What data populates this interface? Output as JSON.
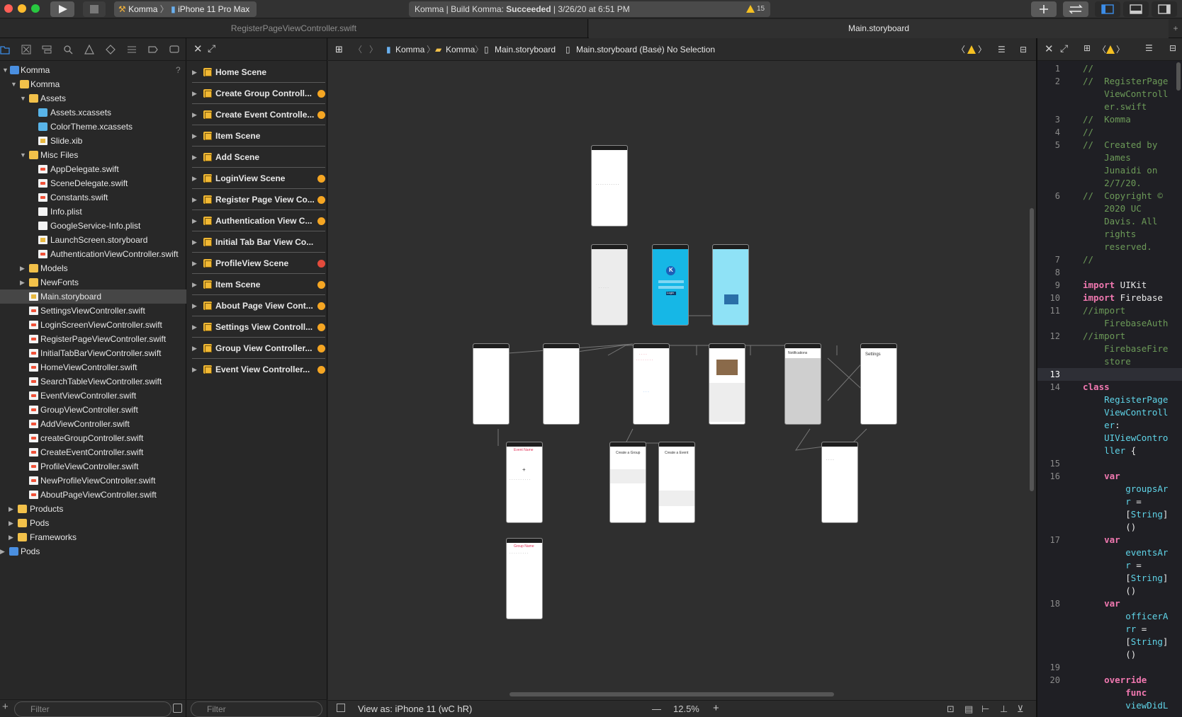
{
  "toolbar": {
    "scheme_project": "Komma",
    "scheme_device": "iPhone 11 Pro Max",
    "status_prefix": "Komma | Build Komma: ",
    "status_result": "Succeeded",
    "status_time": "| 3/26/20 at 6:51 PM",
    "warning_count": "15"
  },
  "tabs": [
    {
      "label": "RegisterPageViewController.swift"
    },
    {
      "label": "Main.storyboard"
    }
  ],
  "navigator": {
    "items": [
      {
        "label": "Komma",
        "help": "?"
      },
      {
        "label": "Komma"
      },
      {
        "label": "Assets"
      },
      {
        "label": "Assets.xcassets"
      },
      {
        "label": "ColorTheme.xcassets"
      },
      {
        "label": "Slide.xib"
      },
      {
        "label": "Misc Files"
      },
      {
        "label": "AppDelegate.swift"
      },
      {
        "label": "SceneDelegate.swift"
      },
      {
        "label": "Constants.swift"
      },
      {
        "label": "Info.plist"
      },
      {
        "label": "GoogleService-Info.plist"
      },
      {
        "label": "LaunchScreen.storyboard"
      },
      {
        "label": "AuthenticationViewController.swift"
      },
      {
        "label": "Models"
      },
      {
        "label": "NewFonts"
      },
      {
        "label": "Main.storyboard"
      },
      {
        "label": "SettingsViewController.swift"
      },
      {
        "label": "LoginScreenViewController.swift"
      },
      {
        "label": "RegisterPageViewController.swift"
      },
      {
        "label": "InitialTabBarViewController.swift"
      },
      {
        "label": "HomeViewController.swift"
      },
      {
        "label": "SearchTableViewController.swift"
      },
      {
        "label": "EventViewController.swift"
      },
      {
        "label": "GroupViewController.swift"
      },
      {
        "label": "AddViewController.swift"
      },
      {
        "label": "createGroupController.swift"
      },
      {
        "label": "CreateEventController.swift"
      },
      {
        "label": "ProfileViewController.swift"
      },
      {
        "label": "NewProfileViewController.swift"
      },
      {
        "label": "AboutPageViewController.swift"
      },
      {
        "label": "Products"
      },
      {
        "label": "Pods"
      },
      {
        "label": "Frameworks"
      },
      {
        "label": "Pods"
      }
    ],
    "filter_placeholder": "Filter"
  },
  "outline": {
    "scenes": [
      {
        "label": "Home Scene",
        "badge": "none"
      },
      {
        "label": "Create Group Controll...",
        "badge": "warning"
      },
      {
        "label": "Create Event Controlle...",
        "badge": "warning"
      },
      {
        "label": "Item Scene",
        "badge": "none"
      },
      {
        "label": "Add Scene",
        "badge": "none"
      },
      {
        "label": "LoginView Scene",
        "badge": "warning"
      },
      {
        "label": "Register Page View Co...",
        "badge": "warning"
      },
      {
        "label": "Authentication View C...",
        "badge": "warning"
      },
      {
        "label": "Initial Tab Bar View Co...",
        "badge": "none"
      },
      {
        "label": "ProfileView Scene",
        "badge": "error"
      },
      {
        "label": "Item Scene",
        "badge": "warning"
      },
      {
        "label": "About Page View Cont...",
        "badge": "warning"
      },
      {
        "label": "Settings View Controll...",
        "badge": "warning"
      },
      {
        "label": "Group View Controller...",
        "badge": "warning"
      },
      {
        "label": "Event View Controller...",
        "badge": "warning"
      }
    ],
    "filter_placeholder": "Filter"
  },
  "jumpbar": {
    "crumbs": [
      "Komma",
      "Komma",
      "Main.storyboard",
      "Main.storyboard (Base)",
      "No Selection"
    ]
  },
  "canvas": {
    "view_as": "View as: iPhone 11 (wC hR)",
    "zoom": "12.5%",
    "minus": "—",
    "plus": "+"
  },
  "editor": {
    "lines": [
      {
        "n": "1",
        "segs": [
          {
            "t": "//",
            "c": "cmt"
          }
        ]
      },
      {
        "n": "2",
        "segs": [
          {
            "t": "//  RegisterPage\n    ViewControll\n    er.swift",
            "c": "cmt"
          }
        ]
      },
      {
        "n": "3",
        "segs": [
          {
            "t": "//  Komma",
            "c": "cmt"
          }
        ]
      },
      {
        "n": "4",
        "segs": [
          {
            "t": "//",
            "c": "cmt"
          }
        ]
      },
      {
        "n": "5",
        "segs": [
          {
            "t": "//  Created by\n    James\n    Junaidi on\n    2/7/20.",
            "c": "cmt"
          }
        ]
      },
      {
        "n": "6",
        "segs": [
          {
            "t": "//  Copyright ©\n    2020 UC\n    Davis. All\n    rights\n    reserved.",
            "c": "cmt"
          }
        ]
      },
      {
        "n": "7",
        "segs": [
          {
            "t": "//",
            "c": "cmt"
          }
        ]
      },
      {
        "n": "8",
        "segs": [
          {
            "t": "",
            "c": "pl"
          }
        ]
      },
      {
        "n": "9",
        "segs": [
          {
            "t": "import",
            "c": "kw"
          },
          {
            "t": " UIKit",
            "c": "pl"
          }
        ]
      },
      {
        "n": "10",
        "segs": [
          {
            "t": "import",
            "c": "kw"
          },
          {
            "t": " Firebase",
            "c": "pl"
          }
        ]
      },
      {
        "n": "11",
        "segs": [
          {
            "t": "//import\n    FirebaseAuth",
            "c": "cmt"
          }
        ]
      },
      {
        "n": "12",
        "segs": [
          {
            "t": "//import\n    FirebaseFire\n    store",
            "c": "cmt"
          }
        ]
      },
      {
        "n": "13",
        "segs": [
          {
            "t": "",
            "c": "pl"
          }
        ]
      },
      {
        "n": "14",
        "segs": [
          {
            "t": "class",
            "c": "kw"
          },
          {
            "t": "\n    RegisterPage\n    ViewControll\n    er",
            "c": "ty"
          },
          {
            "t": ":",
            "c": "pl"
          },
          {
            "t": "\n    UIViewContro\n    ller",
            "c": "ty"
          },
          {
            "t": " {",
            "c": "pl"
          }
        ]
      },
      {
        "n": "15",
        "segs": [
          {
            "t": "",
            "c": "pl"
          }
        ]
      },
      {
        "n": "16",
        "segs": [
          {
            "t": "    var",
            "c": "kw"
          },
          {
            "t": "\n        groupsAr\n        r",
            "c": "ty"
          },
          {
            "t": " =\n        [",
            "c": "pl"
          },
          {
            "t": "String",
            "c": "ty"
          },
          {
            "t": "]\n        ()",
            "c": "pl"
          }
        ]
      },
      {
        "n": "17",
        "segs": [
          {
            "t": "    var",
            "c": "kw"
          },
          {
            "t": "\n        eventsAr\n        r",
            "c": "ty"
          },
          {
            "t": " =\n        [",
            "c": "pl"
          },
          {
            "t": "String",
            "c": "ty"
          },
          {
            "t": "]\n        ()",
            "c": "pl"
          }
        ]
      },
      {
        "n": "18",
        "segs": [
          {
            "t": "    var",
            "c": "kw"
          },
          {
            "t": "\n        officerA\n        rr",
            "c": "ty"
          },
          {
            "t": " =\n        [",
            "c": "pl"
          },
          {
            "t": "String",
            "c": "ty"
          },
          {
            "t": "]\n        ()",
            "c": "pl"
          }
        ]
      },
      {
        "n": "19",
        "segs": [
          {
            "t": "",
            "c": "pl"
          }
        ]
      },
      {
        "n": "20",
        "segs": [
          {
            "t": "    override\n        func",
            "c": "kw"
          },
          {
            "t": "\n        viewDidL",
            "c": "ty"
          }
        ]
      }
    ]
  },
  "storyboard": {
    "screen_texts": [
      "K",
      "Login",
      "Event Name",
      "Create a Group",
      "Create a Event",
      "Settings",
      "Group Name",
      "Notifications"
    ]
  }
}
